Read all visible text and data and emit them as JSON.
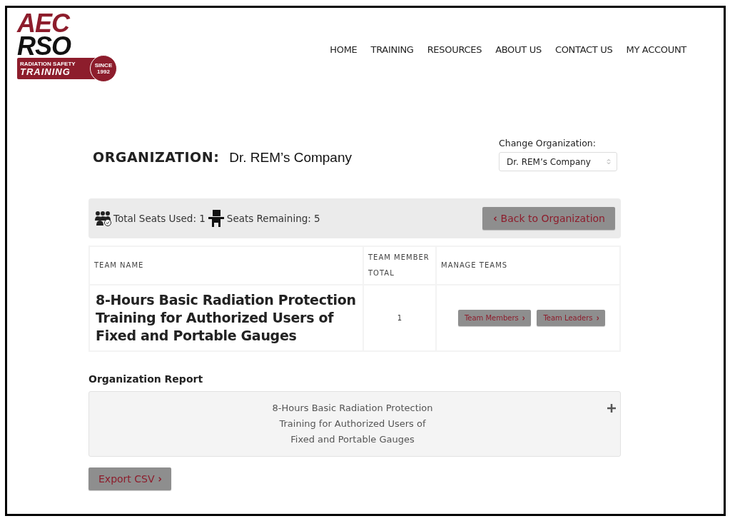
{
  "logo": {
    "line_1": "AEC",
    "line_2": "RSO",
    "tagline": "RADIATION SAFETY",
    "training": "TRAINING",
    "since": "SINCE",
    "year": "1992"
  },
  "nav": [
    "HOME",
    "TRAINING",
    "RESOURCES",
    "ABOUT US",
    "CONTACT US",
    "MY ACCOUNT"
  ],
  "organization": {
    "label": "ORGANIZATION:",
    "name": "Dr. REM’s Company"
  },
  "change_organization": {
    "label": "Change Organization:",
    "value": "Dr. REM’s Company"
  },
  "seats": {
    "used": "Total Seats Used: 1",
    "remaining": "Seats Remaining: 5"
  },
  "back_button": "Back to Organization",
  "table": {
    "columns": [
      "TEAM NAME",
      "TEAM MEMBER TOTAL",
      "MANAGE TEAMS"
    ],
    "rows": [
      {
        "team_name": "8-Hours Basic Radiation Protection Training for Authorized Users of Fixed and Portable Gauges",
        "total": "1",
        "actions": [
          "Team Members",
          "Team Leaders"
        ]
      }
    ]
  },
  "report": {
    "title": "Organization Report",
    "items": [
      {
        "lines": [
          "8-Hours Basic Radiation Protection",
          "Training for Authorized Users of",
          "Fixed and Portable Gauges"
        ],
        "expanded": false
      }
    ]
  },
  "export_button": "Export CSV"
}
